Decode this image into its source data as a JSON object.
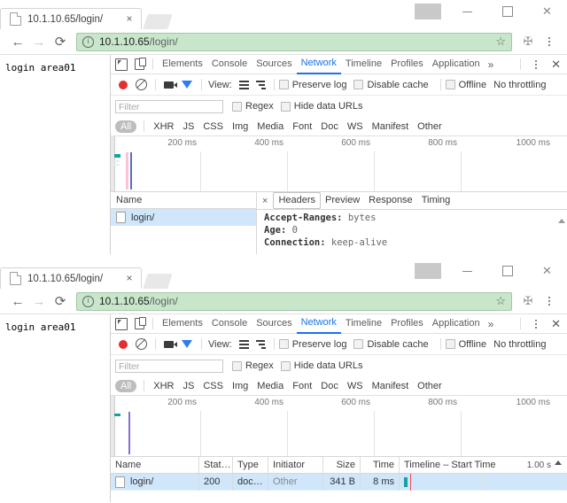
{
  "window": {
    "tab": {
      "title": "10.1.10.65/login/",
      "close": "×",
      "favicon": "page-icon"
    },
    "controls": {
      "profile": "profile-icon",
      "minimize": "–",
      "maximize": "□",
      "close": "✕"
    },
    "nav": {
      "back": "←",
      "forward": "→",
      "reload": "⟳",
      "info": "ⓘ",
      "star": "☆",
      "extension": "✠",
      "menu": "kebab-menu-icon"
    },
    "omnibox": {
      "host": "10.1.10.65",
      "path": "/login/",
      "bg_color": "#c8e6c9"
    }
  },
  "page": {
    "body_text": "login area01"
  },
  "devtools": {
    "panels": [
      "Elements",
      "Console",
      "Sources",
      "Network",
      "Timeline",
      "Profiles",
      "Application"
    ],
    "active_panel": "Network",
    "more_panels": "»",
    "close": "✕",
    "inspect_icon": "inspect-cursor-icon",
    "device_icon": "device-toolbar-icon",
    "toolbar": {
      "record_label": "record-button",
      "clear_label": "clear-button",
      "capture_label": "capture-screenshots",
      "filter_label": "filter-toggle",
      "view_label": "View:",
      "view_list": "list-view-icon",
      "view_waterfall": "waterfall-view-icon",
      "preserve_log": "Preserve log",
      "disable_cache": "Disable cache",
      "offline": "Offline",
      "throttling": "No throttling"
    },
    "filterbar": {
      "placeholder": "Filter",
      "regex": "Regex",
      "hide_data_urls": "Hide data URLs"
    },
    "types": [
      "All",
      "XHR",
      "JS",
      "CSS",
      "Img",
      "Media",
      "Font",
      "Doc",
      "WS",
      "Manifest",
      "Other"
    ],
    "active_type": "All",
    "overview_ticks": [
      "200 ms",
      "400 ms",
      "600 ms",
      "800 ms",
      "1000 ms"
    ],
    "overview_colors": {
      "teal": "#17a2a2",
      "pink": "#ffc0da",
      "blue": "#5b6fc0",
      "purple": "#8a6fd0"
    }
  },
  "window1": {
    "name_column_header": "Name",
    "request_name": "login/",
    "detail_tabs": [
      "Headers",
      "Preview",
      "Response",
      "Timing"
    ],
    "active_detail_tab": "Headers",
    "detail_close": "×",
    "headers": [
      {
        "key": "Accept-Ranges:",
        "value": "bytes"
      },
      {
        "key": "Age:",
        "value": "0"
      },
      {
        "key": "Connection:",
        "value": "keep-alive"
      }
    ]
  },
  "window2": {
    "columns": [
      "Name",
      "Stat…",
      "Type",
      "Initiator",
      "Size",
      "Time",
      "Timeline – Start Time"
    ],
    "timeline_scale": "1.00 s",
    "rows": [
      {
        "name": "login/",
        "status": "200",
        "type": "doc…",
        "initiator": "Other",
        "size": "341 B",
        "time": "8 ms"
      }
    ]
  }
}
